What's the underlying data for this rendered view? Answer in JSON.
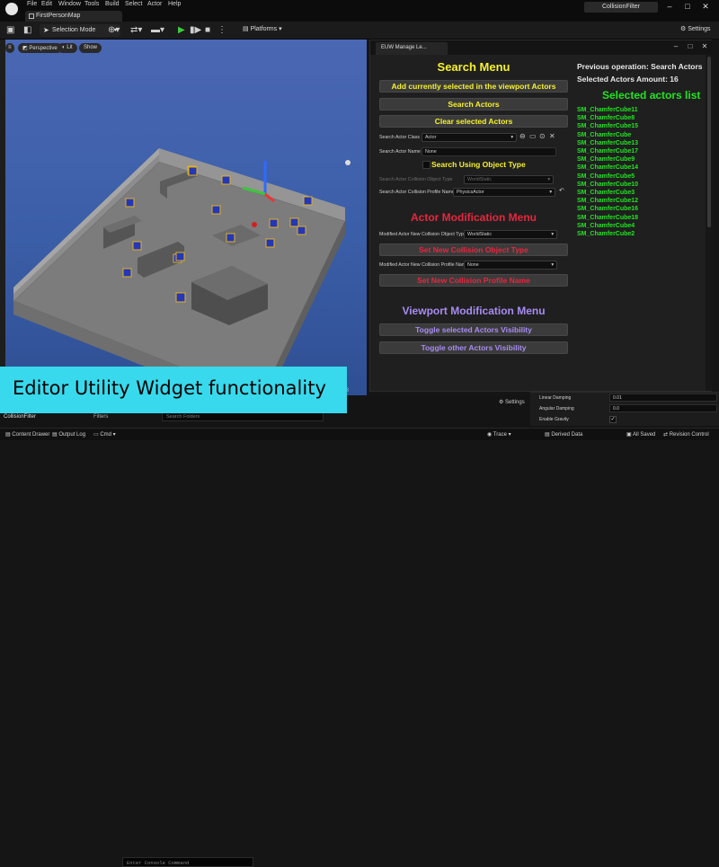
{
  "menu": [
    "File",
    "Edit",
    "Window",
    "Tools",
    "Build",
    "Select",
    "Actor",
    "Help"
  ],
  "map_tab": "FirstPersonMap",
  "project_tab": "CollisionFilter",
  "toolbar": {
    "selection_mode": "Selection Mode",
    "platforms": "Platforms",
    "settings": "Settings"
  },
  "viewport": {
    "perspective": "Perspective",
    "lit": "Lit",
    "show": "Show"
  },
  "panel": {
    "tab": "EUW Manage Le...",
    "search_menu": {
      "title": "Search Menu",
      "add_selected": "Add currently selected in the viewport Actors",
      "search_actors": "Search Actors",
      "clear_selected": "Clear selected Actors",
      "actor_class_label": "Search Actor Class",
      "actor_class_value": "Actor",
      "actor_name_label": "Search Actor Name",
      "actor_name_value": "None",
      "search_using_object_type": "Search Using Object Type",
      "collision_object_type_label": "Search Actor Collision Object Type",
      "collision_object_type_value": "WorldStatic",
      "collision_profile_label": "Search Actor Collision Profile Name",
      "collision_profile_value": "PhysicsActor"
    },
    "actor_mod_menu": {
      "title": "Actor Modification Menu",
      "new_object_type_label": "Modified Actor New Collision Object Type",
      "new_object_type_value": "WorldStatic",
      "set_object_type": "Set New Collision Object Type",
      "new_profile_label": "Modified Actor New Collision Profile Name",
      "new_profile_value": "None",
      "set_profile": "Set New Collision Profile Name"
    },
    "viewport_mod_menu": {
      "title": "Viewport Modification Menu",
      "toggle_selected": "Toggle selected Actors Visibility",
      "toggle_other": "Toggle other Actors Visibility"
    },
    "previous_operation": "Previous operation: Search Actors",
    "selected_amount": "Selected Actors Amount: 16",
    "selected_list_title": "Selected actors list",
    "selected_actors": [
      "SM_ChamferCube11",
      "SM_ChamferCube8",
      "SM_ChamferCube15",
      "SM_ChamferCube",
      "SM_ChamferCube13",
      "SM_ChamferCube17",
      "SM_ChamferCube9",
      "SM_ChamferCube14",
      "SM_ChamferCube5",
      "SM_ChamferCube10",
      "SM_ChamferCube3",
      "SM_ChamferCube12",
      "SM_ChamferCube16",
      "SM_ChamferCube18",
      "SM_ChamferCube4",
      "SM_ChamferCube2"
    ]
  },
  "details": {
    "linear_damping_label": "Linear Damping",
    "linear_damping_value": "0.01",
    "angular_damping_label": "Angular Damping",
    "angular_damping_value": "0.0",
    "enable_gravity_label": "Enable Gravity"
  },
  "bottom": {
    "settings": "Settings",
    "filters": "Filters",
    "outliner_item": "CollisionFilter",
    "search_placeholder": "Search Folders",
    "tab_fragment": "r 3"
  },
  "statusbar": {
    "content_drawer": "Content Drawer",
    "output_log": "Output Log",
    "cmd": "Cmd",
    "console_placeholder": "Enter Console Command",
    "trace": "Trace",
    "derived_data": "Derived Data",
    "all_saved": "All Saved",
    "revision_control": "Revision Control"
  },
  "caption": "Editor Utility Widget functionality",
  "colors": {
    "yellow": "#f6f22a",
    "red": "#e8263e",
    "purple": "#a78cf2",
    "green": "#21e321",
    "caption_bg": "#38d9ec"
  }
}
